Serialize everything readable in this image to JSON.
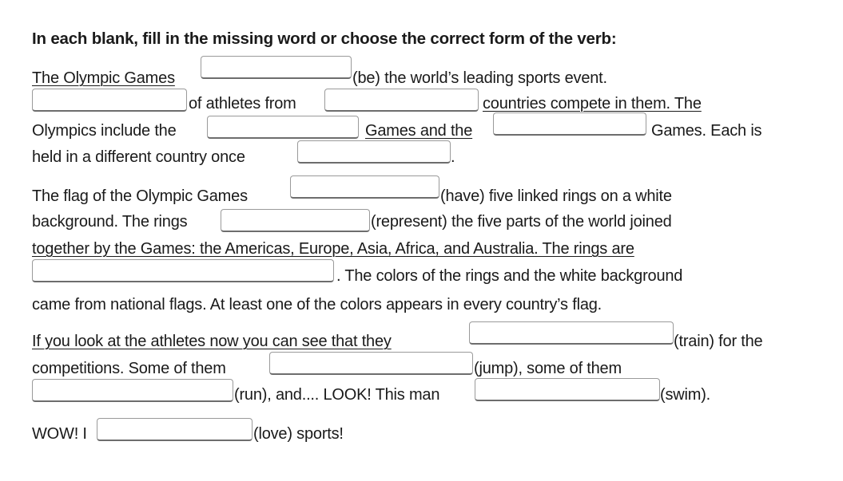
{
  "instruction": "In each blank, fill in the missing word or choose the correct form of the verb:",
  "p1": {
    "l1a": "The Olympic Games",
    "l1b": "(be) the world’s leading sports event.",
    "l2a": "of athletes from",
    "l2b": "countries compete in them. The",
    "l3a": "Olympics include the",
    "l3b": "Games and the",
    "l3c": "Games. Each is",
    "l4a": "held in a different country once",
    "l4b": "."
  },
  "p2": {
    "l1a": "The flag of the Olympic Games",
    "l1b": "(have) five linked rings on a white",
    "l2a": "background. The rings",
    "l2b": "(represent) the five parts of the world joined",
    "l3": "together by the Games: the Americas, Europe, Asia, Africa, and Australia. The rings are",
    "l4b": ". The colors of the rings and the white background",
    "l5": "came from national flags. At least one of the colors appears in every country’s flag."
  },
  "p3": {
    "l1a": "If you look at the athletes now you can see that they",
    "l1b": "(train) for the",
    "l2a": "competitions. Some of them",
    "l2b": "(jump), some of them",
    "l3b": "(run), and.... LOOK! This man",
    "l3c": "(swim)."
  },
  "p4": {
    "l1a": "WOW! I",
    "l1b": "(love) sports!"
  },
  "blanks": [
    "",
    "",
    "",
    "",
    "",
    "",
    "",
    "",
    "",
    "",
    "",
    "",
    "",
    "",
    ""
  ]
}
